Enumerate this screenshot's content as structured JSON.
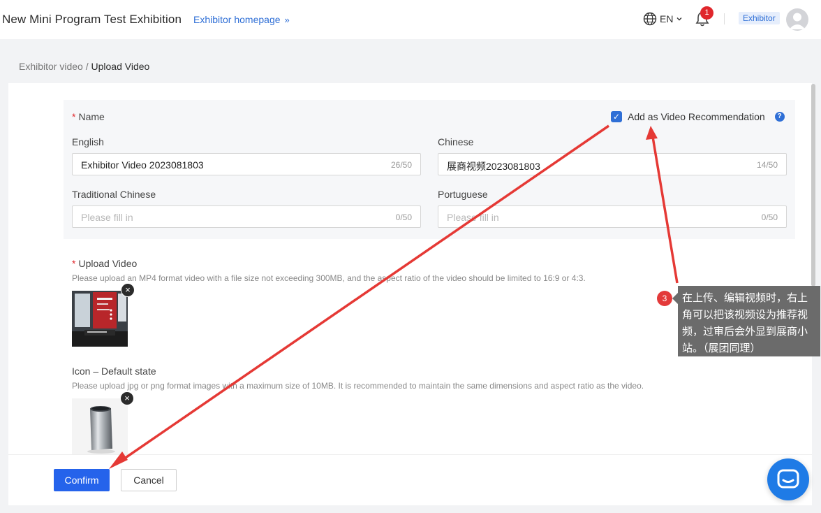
{
  "header": {
    "title": "New Mini Program Test Exhibition",
    "homepage_link": "Exhibitor homepage",
    "language": "EN",
    "notification_count": "1",
    "role": "Exhibitor"
  },
  "breadcrumb": {
    "parent": "Exhibitor video",
    "separator": "/",
    "current": "Upload Video"
  },
  "form": {
    "name": {
      "required_mark": "*",
      "label": "Name",
      "recommend_label": "Add as Video Recommendation",
      "recommend_checked": true,
      "help_icon": "question-icon",
      "fields": [
        {
          "label": "English",
          "value": "Exhibitor Video 2023081803",
          "placeholder": "",
          "count": "26/50"
        },
        {
          "label": "Chinese",
          "value": "展商视频2023081803",
          "placeholder": "",
          "count": "14/50"
        },
        {
          "label": "Traditional Chinese",
          "value": "",
          "placeholder": "Please fill in",
          "count": "0/50"
        },
        {
          "label": "Portuguese",
          "value": "",
          "placeholder": "Please fill in",
          "count": "0/50"
        }
      ]
    },
    "video": {
      "required_mark": "*",
      "label": "Upload Video",
      "hint": "Please upload an MP4 format video with a file size not exceeding 300MB, and the aspect ratio of the video should be limited to 16:9 or 4:3."
    },
    "icon": {
      "label": "Icon – Default state",
      "hint": "Please upload jpg or png format images with a maximum size of 10MB. It is recommended to maintain the same dimensions and aspect ratio as the video."
    }
  },
  "actions": {
    "confirm": "Confirm",
    "cancel": "Cancel"
  },
  "annotation": {
    "number": "3",
    "text": "在上传、编辑视频时，右上角可以把该视频设为推荐视频，过审后会外显到展商小站。（展团同理）"
  },
  "colors": {
    "accent": "#2f6fd6",
    "primary_button": "#2563eb",
    "annotation_red": "#e33a3a",
    "annotation_bg": "#6b6b6b"
  }
}
